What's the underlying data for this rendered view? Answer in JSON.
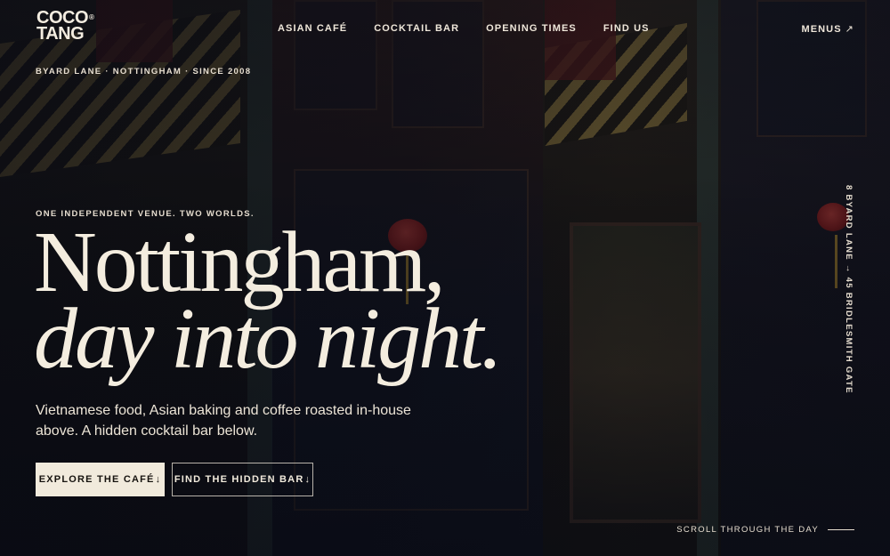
{
  "brand": {
    "line1": "COCO",
    "line2": "TANG",
    "mark": "®"
  },
  "nav": {
    "items": [
      {
        "label": "ASIAN CAFÉ"
      },
      {
        "label": "COCKTAIL BAR"
      },
      {
        "label": "OPENING TIMES"
      },
      {
        "label": "FIND US"
      }
    ],
    "menus": {
      "label": "MENUS",
      "icon": "↗"
    }
  },
  "location": "BYARD LANE · NOTTINGHAM · SINCE 2008",
  "hero": {
    "eyebrow": "ONE INDEPENDENT VENUE. TWO WORLDS.",
    "title_line1": "Nottingham,",
    "title_line2": "day into night.",
    "subtitle": "Vietnamese food, Asian baking and coffee roasted in-house above. A hidden cocktail bar below.",
    "primary_cta": {
      "label": "EXPLORE THE CAFÉ",
      "icon": "↓"
    },
    "secondary_cta": {
      "label": "FIND THE HIDDEN BAR",
      "icon": "↓"
    }
  },
  "address_vertical": "8 BYARD LANE → 45 BRIDLESMITH GATE",
  "scroll_hint": "SCROLL THROUGH THE DAY",
  "colors": {
    "cream": "#f3ece0",
    "night": "#0c0e18",
    "lantern_red": "#d23a30"
  }
}
